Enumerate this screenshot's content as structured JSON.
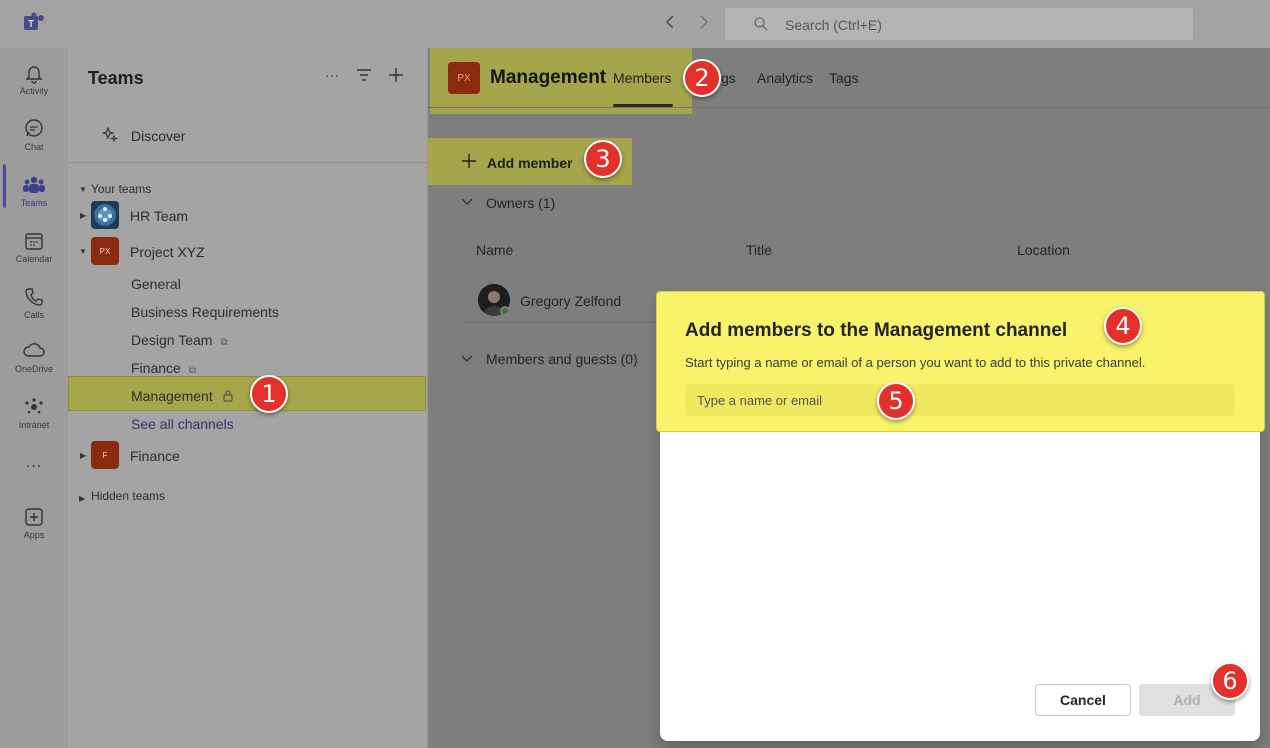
{
  "topbar": {
    "search_placeholder": "Search (Ctrl+E)",
    "back_icon": "chevron-left-icon",
    "forward_icon": "chevron-right-icon"
  },
  "rail": {
    "items": [
      {
        "label": "Activity",
        "icon": "bell-icon"
      },
      {
        "label": "Chat",
        "icon": "chat-icon"
      },
      {
        "label": "Teams",
        "icon": "teams-icon"
      },
      {
        "label": "Calendar",
        "icon": "calendar-icon"
      },
      {
        "label": "Calls",
        "icon": "phone-icon"
      },
      {
        "label": "OneDrive",
        "icon": "cloud-icon"
      },
      {
        "label": "Intranet",
        "icon": "intranet-icon"
      },
      {
        "label": "...",
        "icon": "more-icon"
      },
      {
        "label": "Apps",
        "icon": "apps-icon"
      }
    ],
    "active": "Teams"
  },
  "panel": {
    "title": "Teams",
    "more": "···",
    "discover": "Discover",
    "your_teams": "Your teams",
    "teams": [
      {
        "name": "HR Team"
      },
      {
        "name": "Project XYZ",
        "initials": "PX"
      },
      {
        "name": "Finance",
        "initials": "F"
      }
    ],
    "channels": [
      {
        "name": "General"
      },
      {
        "name": "Business Requirements"
      },
      {
        "name": "Design Team"
      },
      {
        "name": "Finance"
      },
      {
        "name": "Management"
      }
    ],
    "see_all": "See all channels",
    "hidden_teams": "Hidden teams"
  },
  "main": {
    "channel_initials": "PX",
    "channel_title": "Management",
    "tabs": [
      "Members",
      "gs",
      "Analytics",
      "Tags"
    ],
    "active_tab": "Members",
    "add_member": "Add member",
    "owners": "Owners (1)",
    "columns": [
      "Name",
      "Title",
      "Location"
    ],
    "member": "Gregory Zelfond",
    "guests": "Members and guests (0)"
  },
  "dialog": {
    "title": "Add members to the Management channel",
    "subtitle": "Start typing a name or email of a person you want to add to this private channel.",
    "input_placeholder": "Type a name or email",
    "cancel": "Cancel",
    "add": "Add"
  },
  "markers": [
    "1",
    "2",
    "3",
    "4",
    "5",
    "6"
  ],
  "colors": {
    "highlight": "#f8f36a",
    "marker": "#e3302a",
    "accent": "#4a4aa0",
    "link": "#333372"
  }
}
